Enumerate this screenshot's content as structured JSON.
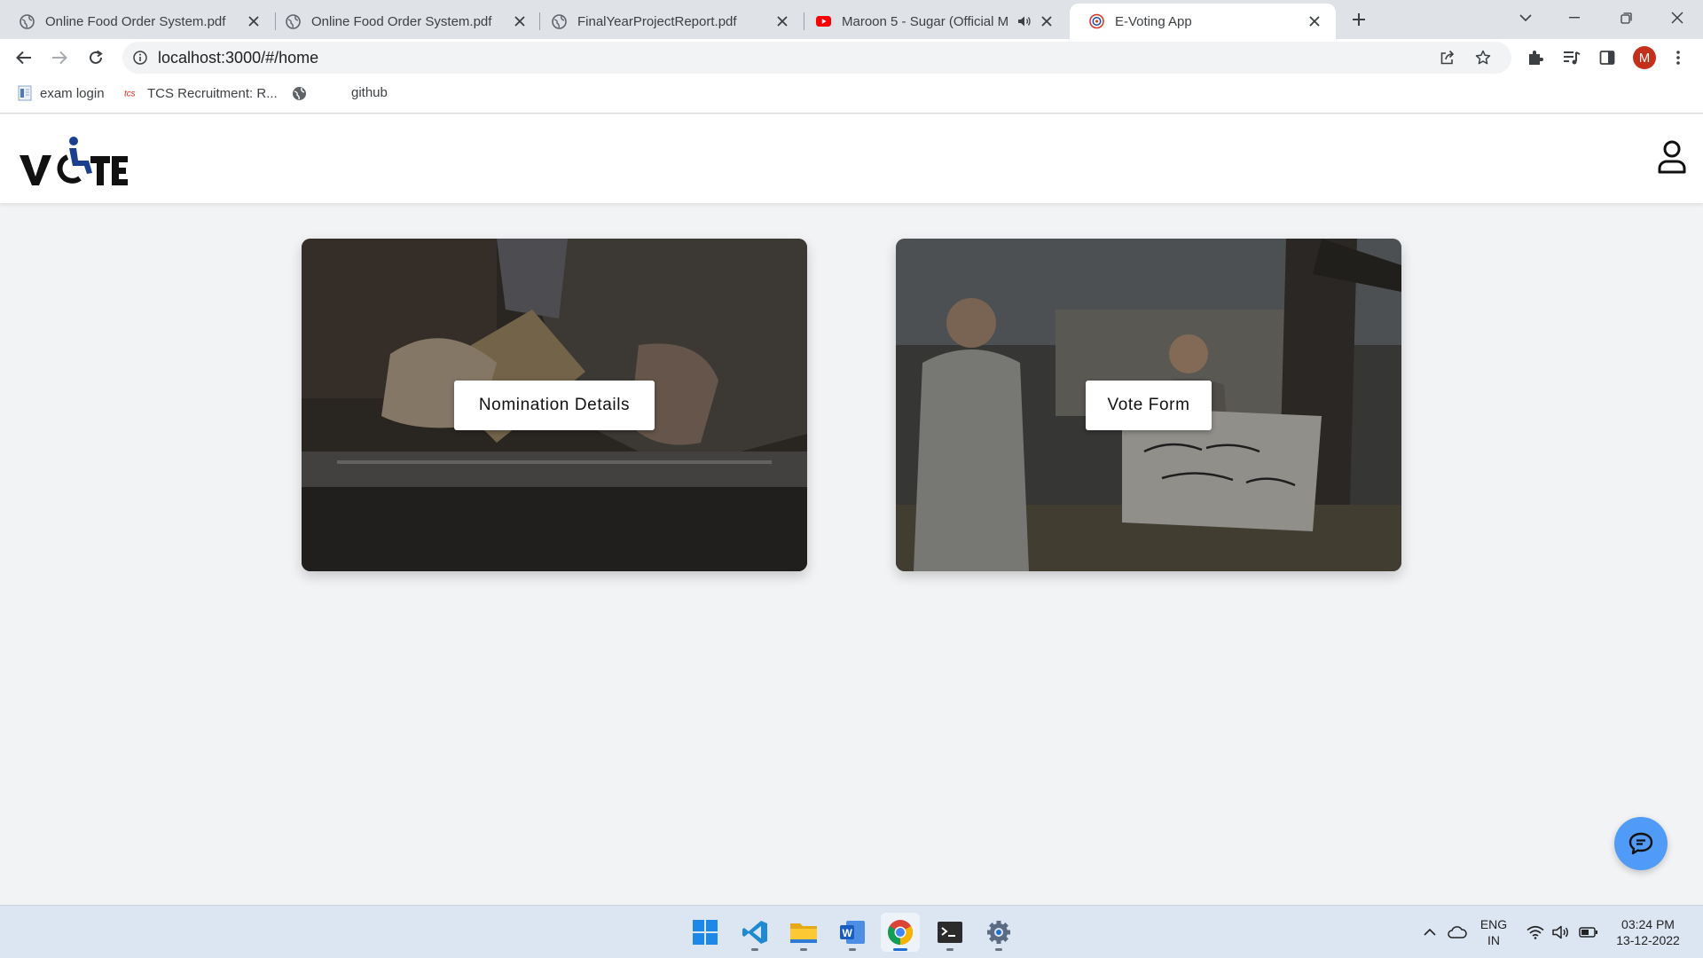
{
  "browser": {
    "tabs": [
      {
        "title": "Online Food Order System.pdf",
        "favicon": "globe-icon",
        "active": false
      },
      {
        "title": "Online Food Order System.pdf",
        "favicon": "globe-icon",
        "active": false
      },
      {
        "title": "FinalYearProjectReport.pdf",
        "favicon": "globe-icon",
        "active": false
      },
      {
        "title": "Maroon 5 - Sugar (Official M",
        "favicon": "youtube-icon",
        "active": false
      },
      {
        "title": "E-Voting App",
        "favicon": "vote-favicon-icon",
        "active": true
      }
    ],
    "address": "localhost:3000/#/home",
    "profile_initial": "M",
    "bookmarks": [
      {
        "label": "exam login",
        "icon": "document-icon"
      },
      {
        "label": "TCS Recruitment: R...",
        "icon": "tcs-icon"
      },
      {
        "label": "",
        "icon": "globe-icon"
      },
      {
        "label": "github",
        "icon": "none"
      }
    ]
  },
  "app": {
    "logo_text": "V TE",
    "cards": [
      {
        "button_label": "Nomination Details"
      },
      {
        "button_label": "Vote Form"
      }
    ]
  },
  "taskbar": {
    "apps": [
      "windows-start-icon",
      "vscode-icon",
      "file-explorer-icon",
      "word-icon",
      "chrome-icon",
      "terminal-icon",
      "settings-icon"
    ],
    "lang_line1": "ENG",
    "lang_line2": "IN",
    "time": "03:24 PM",
    "date": "13-12-2022"
  },
  "colors": {
    "accent_blue": "#4f9bf7",
    "profile_red": "#c5301d",
    "logo_blue": "#1b3f8f"
  }
}
